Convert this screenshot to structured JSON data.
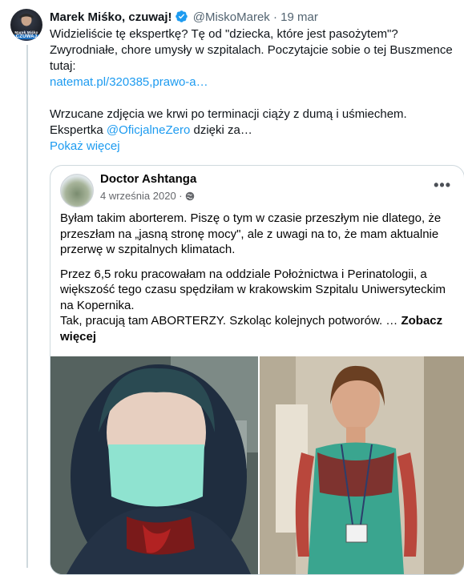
{
  "tweet": {
    "author_name": "Marek Miśko, czuwaj!",
    "handle": "@MiskoMarek",
    "separator": "·",
    "date": "19 mar",
    "avatar_brand_top": "Marek Miśko",
    "avatar_brand_bottom": "CZUWAJ",
    "line1": "Widzieliście tę ekspertkę? Tę od \"dziecka, które jest pasożytem\"? Zwyrodniałe, chore umysły w szpitalach. Poczytajcie sobie o tej Buszmence tutaj:",
    "link": "natemat.pl/320385,prawo-a…",
    "line2": "Wrzucane zdjęcia we krwi po terminacji ciąży z dumą i uśmiechem.",
    "line3_prefix": "Ekspertka ",
    "mention": "@OficjalneZero",
    "line3_suffix": " dzięki za…",
    "show_more": "Pokaż więcej"
  },
  "embed": {
    "page_name": "Doctor Ashtanga",
    "date": "4 września 2020 ·",
    "more": "•••",
    "p1": "Byłam takim aborterem. Piszę o tym w czasie przeszłym nie dlatego, że przeszłam na „jasną stronę mocy\", ale z uwagi na to, że mam aktualnie przerwę w szpitalnych klimatach.",
    "p2a": "Przez 6,5 roku pracowałam na oddziale Położnictwa i Perinatologii, a większość tego czasu spędziłam w krakowskim Szpitalu Uniwersyteckim na Kopernika.",
    "p2b": "Tak, pracują tam ABORTERZY. Szkoląc kolejnych potworów. … ",
    "see_more": "Zobacz więcej"
  },
  "colors": {
    "link": "#1d9bf0",
    "verified": "#1d9bf0",
    "muted": "#536471",
    "border": "#cfd9de"
  },
  "icons": {
    "verified": "verified-badge-icon",
    "globe": "globe-icon",
    "more": "more-options-icon"
  }
}
